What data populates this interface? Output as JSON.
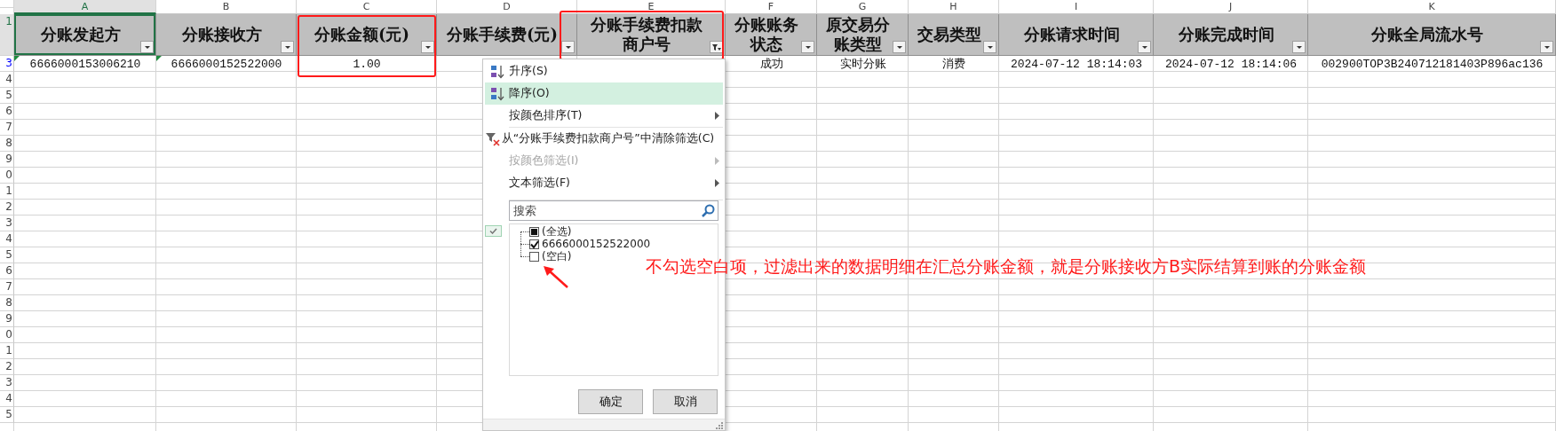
{
  "column_letters": [
    {
      "label": "A",
      "selected": true
    },
    {
      "label": "B",
      "selected": false
    },
    {
      "label": "C",
      "selected": false
    },
    {
      "label": "D",
      "selected": false
    },
    {
      "label": "E",
      "selected": false
    },
    {
      "label": "F",
      "selected": false
    },
    {
      "label": "G",
      "selected": false
    },
    {
      "label": "H",
      "selected": false
    },
    {
      "label": "I",
      "selected": false
    },
    {
      "label": "J",
      "selected": false
    },
    {
      "label": "K",
      "selected": false
    }
  ],
  "row_numbers": [
    {
      "label": "1",
      "selected": true,
      "filtered": false
    },
    {
      "label": "3",
      "selected": false,
      "filtered": true
    },
    {
      "label": "4",
      "selected": false,
      "filtered": false
    },
    {
      "label": "5",
      "selected": false,
      "filtered": false
    },
    {
      "label": "6",
      "selected": false,
      "filtered": false
    },
    {
      "label": "7",
      "selected": false,
      "filtered": false
    },
    {
      "label": "8",
      "selected": false,
      "filtered": false
    },
    {
      "label": "9",
      "selected": false,
      "filtered": false
    },
    {
      "label": "0",
      "selected": false,
      "filtered": false
    },
    {
      "label": "1",
      "selected": false,
      "filtered": false
    },
    {
      "label": "2",
      "selected": false,
      "filtered": false
    },
    {
      "label": "3",
      "selected": false,
      "filtered": false
    },
    {
      "label": "4",
      "selected": false,
      "filtered": false
    },
    {
      "label": "5",
      "selected": false,
      "filtered": false
    },
    {
      "label": "6",
      "selected": false,
      "filtered": false
    },
    {
      "label": "7",
      "selected": false,
      "filtered": false
    },
    {
      "label": "8",
      "selected": false,
      "filtered": false
    },
    {
      "label": "9",
      "selected": false,
      "filtered": false
    },
    {
      "label": "0",
      "selected": false,
      "filtered": false
    },
    {
      "label": "1",
      "selected": false,
      "filtered": false
    },
    {
      "label": "2",
      "selected": false,
      "filtered": false
    },
    {
      "label": "3",
      "selected": false,
      "filtered": false
    },
    {
      "label": "4",
      "selected": false,
      "filtered": false
    },
    {
      "label": "5",
      "selected": false,
      "filtered": false
    }
  ],
  "headers": [
    {
      "lines": [
        "分账发起方"
      ],
      "filter_applied": false,
      "annotated": false
    },
    {
      "lines": [
        "分账接收方"
      ],
      "filter_applied": false,
      "annotated": false
    },
    {
      "lines": [
        "分账金额(元)"
      ],
      "filter_applied": false,
      "annotated": true
    },
    {
      "lines": [
        "分账手续费(元)"
      ],
      "filter_applied": false,
      "annotated": false
    },
    {
      "lines": [
        "分账手续费扣款",
        "商户号"
      ],
      "filter_applied": true,
      "annotated": true
    },
    {
      "lines": [
        "分账账务",
        "状态"
      ],
      "filter_applied": false,
      "annotated": false
    },
    {
      "lines": [
        "原交易分",
        "账类型"
      ],
      "filter_applied": false,
      "annotated": false
    },
    {
      "lines": [
        "交易类型"
      ],
      "filter_applied": false,
      "annotated": false
    },
    {
      "lines": [
        "分账请求时间"
      ],
      "filter_applied": false,
      "annotated": false
    },
    {
      "lines": [
        "分账完成时间"
      ],
      "filter_applied": false,
      "annotated": false
    },
    {
      "lines": [
        "分账全局流水号"
      ],
      "filter_applied": false,
      "annotated": false
    }
  ],
  "data_row_left": [
    {
      "text": "6666000153006210",
      "flagged": true
    },
    {
      "text": "6666000152522000",
      "flagged": true
    },
    {
      "text": "1.00",
      "flagged": false
    }
  ],
  "data_row_right": [
    {
      "text": "成功",
      "flagged": false
    },
    {
      "text": "实时分账",
      "flagged": false
    },
    {
      "text": "消费",
      "flagged": false
    },
    {
      "text": "2024-07-12 18:14:03",
      "flagged": false
    },
    {
      "text": "2024-07-12 18:14:06",
      "flagged": false
    },
    {
      "text": "002900TOP3B240712181403P896ac136",
      "flagged": false
    }
  ],
  "filter_menu": {
    "items": [
      {
        "kind": "sort-asc",
        "label": "升序(S)",
        "selected": false,
        "disabled": false,
        "submenu": false
      },
      {
        "kind": "sort-desc",
        "label": "降序(O)",
        "selected": true,
        "disabled": false,
        "submenu": false
      },
      {
        "kind": "plain",
        "label": "按颜色排序(T)",
        "selected": false,
        "disabled": false,
        "submenu": true
      },
      {
        "kind": "clear-filter",
        "label": "从“分账手续费扣款商户号”中清除筛选(C)",
        "selected": false,
        "disabled": false,
        "submenu": false
      },
      {
        "kind": "plain",
        "label": "按颜色筛选(I)",
        "selected": false,
        "disabled": true,
        "submenu": true
      },
      {
        "kind": "plain",
        "label": "文本筛选(F)",
        "selected": false,
        "disabled": false,
        "submenu": true
      }
    ],
    "search": {
      "placeholder": "搜索"
    },
    "values": [
      {
        "label": "(全选)",
        "checked": false,
        "partial": true
      },
      {
        "label": "6666000152522000",
        "checked": true,
        "partial": false
      },
      {
        "label": "(空白)",
        "checked": false,
        "partial": false
      }
    ],
    "buttons": [
      "确定",
      "取消"
    ]
  },
  "annotation": {
    "text": "不勾选空白项，过滤出来的数据明细在汇总分账金额，就是分账接收方B实际结算到账的分账金额"
  }
}
